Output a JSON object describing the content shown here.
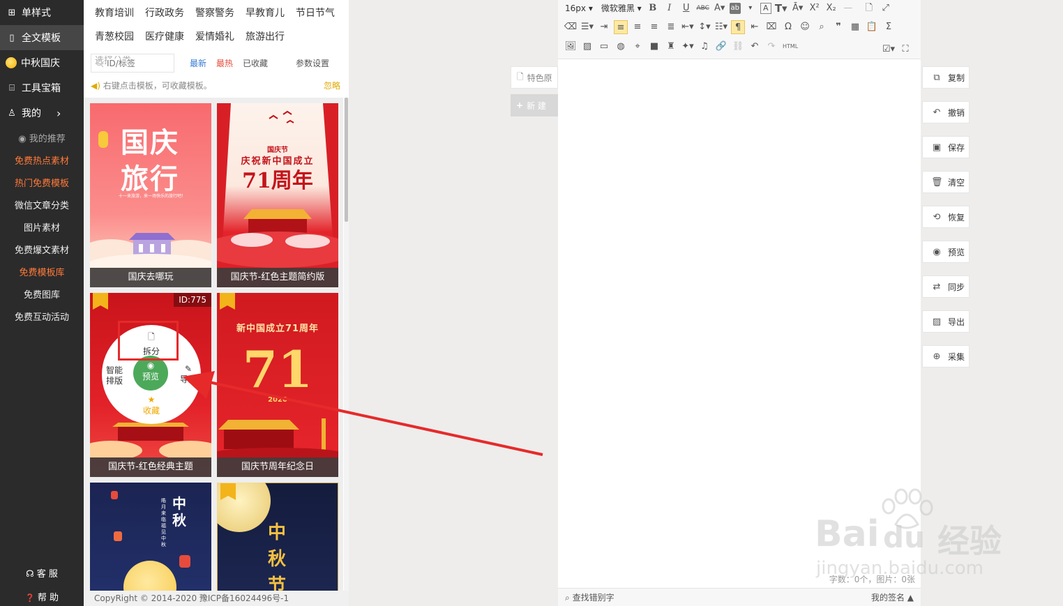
{
  "nav": {
    "main": [
      {
        "icon": "grid-icon",
        "glyph": "⊞",
        "label": "单样式"
      },
      {
        "icon": "layout-icon",
        "glyph": "▯",
        "label": "全文模板"
      },
      {
        "icon": "moon-icon",
        "glyph": "",
        "label": "中秋国庆"
      },
      {
        "icon": "toolbox-icon",
        "glyph": "⌸",
        "label": "工具宝箱"
      },
      {
        "icon": "user-icon",
        "glyph": "♙",
        "label": "我的",
        "arrow": "›"
      }
    ],
    "sub": [
      {
        "label": "我的推荐",
        "style": "gray",
        "icon": "eye-icon",
        "glyph": "◉"
      },
      {
        "label": "免费热点素材",
        "style": "hot"
      },
      {
        "label": "热门免费模板",
        "style": "hot"
      },
      {
        "label": "微信文章分类",
        "style": ""
      },
      {
        "label": "图片素材",
        "style": ""
      },
      {
        "label": "免费爆文素材",
        "style": ""
      },
      {
        "label": "免费模板库",
        "style": "hot"
      },
      {
        "label": "免费图库",
        "style": ""
      },
      {
        "label": "免费互动活动",
        "style": ""
      }
    ],
    "service": {
      "glyph": "☊",
      "label": "客 服"
    },
    "help": {
      "glyph": "❓",
      "label": "帮 助"
    }
  },
  "categories": [
    "教育培训",
    "行政政务",
    "警察警务",
    "早教育儿",
    "节日节气",
    "青葱校园",
    "医疗健康",
    "爱情婚礼",
    "旅游出行"
  ],
  "category_more": "选择分类 »",
  "search": {
    "placeholder": "ID/标签"
  },
  "tabs": [
    {
      "label": "最新",
      "color": "#3a7bd5"
    },
    {
      "label": "最热",
      "color": "#e64c3c"
    },
    {
      "label": "已收藏",
      "color": "#555555"
    },
    {
      "label": "参数设置",
      "color": "#555555"
    }
  ],
  "tip": {
    "text": "右键点击模板，可收藏模板。",
    "ignore": "忽略"
  },
  "cards": [
    {
      "caption": "国庆去哪玩",
      "art_text": [
        "国庆",
        "旅行"
      ],
      "art_small": "十一来旅游，来一场快乐的旅行吧！"
    },
    {
      "caption": "国庆节-红色主题简约版",
      "art_small": "国庆节",
      "art_line": "庆祝新中国成立",
      "art_big": "71周年"
    },
    {
      "caption": "国庆节-红色经典主题",
      "id_tag": "ID:775"
    },
    {
      "caption": "国庆节周年纪念日",
      "art_line": "新中国成立71周年",
      "art_big": "71",
      "art_year": "2020"
    },
    {
      "caption": "",
      "art_big": "中秋",
      "art_small": "皓月来临 福见中秋"
    },
    {
      "caption": "",
      "art_big": "中秋节"
    }
  ],
  "hover_menu": {
    "split": "拆分",
    "smart": "智能排版",
    "preview": "预览",
    "import": "导入",
    "favorite": "收藏"
  },
  "copyright": "CopyRight © 2014-2020 豫ICP备16024496号-1",
  "side_tabs": {
    "featured": "特色原",
    "new": "新 建"
  },
  "toolbar": {
    "font_size": "16px",
    "font_family": "微软雅黑",
    "html_label": "HTML"
  },
  "word_count": "字数：0个，图片：0张",
  "status": {
    "spellcheck": "查找错别字",
    "signature": "我的签名 ▲"
  },
  "right_buttons": [
    {
      "label": "复制",
      "icon": "copy-icon",
      "glyph": "⧉"
    },
    {
      "label": "撤销",
      "icon": "undo-icon",
      "glyph": "↶"
    },
    {
      "label": "保存",
      "icon": "save-icon",
      "glyph": "▣"
    },
    {
      "label": "清空",
      "icon": "trash-icon",
      "glyph": "🗑"
    },
    {
      "label": "恢复",
      "icon": "restore-icon",
      "glyph": "⟲"
    },
    {
      "label": "预览",
      "icon": "eye-icon",
      "glyph": "◉"
    },
    {
      "label": "同步",
      "icon": "sync-icon",
      "glyph": "⇄"
    },
    {
      "label": "导出",
      "icon": "export-icon",
      "glyph": "▨"
    },
    {
      "label": "采集",
      "icon": "collect-icon",
      "glyph": "⊕"
    }
  ],
  "watermark": {
    "brand": "Bai",
    "brand2": "du",
    "cn": "经验",
    "url": "jingyan.baidu.com"
  },
  "colors": {
    "accent_hot": "#ff7a3a",
    "preview_green": "#4ca95a",
    "highlight_red": "#e62a2a",
    "nav_bg": "#2b2b2b"
  }
}
